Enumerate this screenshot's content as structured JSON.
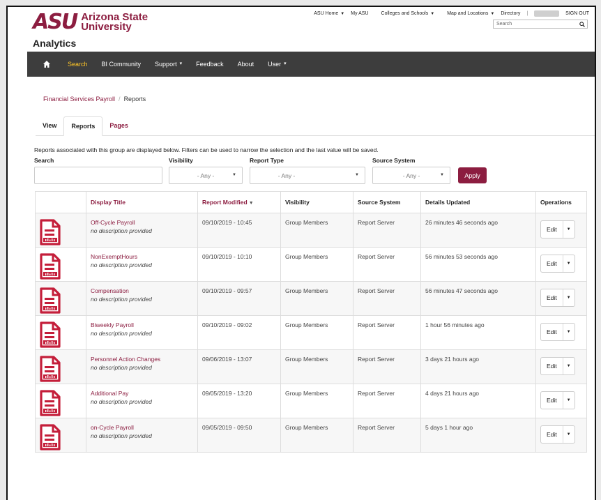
{
  "header": {
    "logo_mark": "ASU",
    "logo_line1": "Arizona State",
    "logo_line2": "University",
    "topnav": [
      "ASU Home",
      "My ASU",
      "Colleges and Schools",
      "Map and Locations",
      "Directory"
    ],
    "sign_out": "SIGN OUT",
    "search_placeholder": "Search",
    "app_title": "Analytics"
  },
  "navbar": {
    "items": [
      {
        "label": "Search",
        "active": true
      },
      {
        "label": "BI Community"
      },
      {
        "label": "Support"
      },
      {
        "label": "Feedback"
      },
      {
        "label": "About"
      },
      {
        "label": "User"
      }
    ]
  },
  "breadcrumb": {
    "parent": "Financial Services Payroll",
    "current": "Reports"
  },
  "tabs": [
    "View",
    "Reports",
    "Pages"
  ],
  "filters": {
    "description": "Reports associated with this group are displayed below. Filters can be used to narrow the selection and the last value will be saved.",
    "search_label": "Search",
    "visibility_label": "Visibility",
    "visibility_value": "- Any -",
    "report_type_label": "Report Type",
    "report_type_value": "- Any -",
    "source_system_label": "Source System",
    "source_system_value": "- Any -",
    "apply_label": "Apply"
  },
  "table": {
    "headers": {
      "title": "Display Title",
      "modified": "Report Modified",
      "visibility": "Visibility",
      "source": "Source System",
      "updated": "Details Updated",
      "operations": "Operations"
    },
    "edit_label": "Edit",
    "rows": [
      {
        "title": "Off-Cycle Payroll",
        "desc": "no description provided",
        "modified": "09/10/2019 - 10:45",
        "visibility": "Group Members",
        "source": "Report Server",
        "updated": "26 minutes 46 seconds ago"
      },
      {
        "title": "NonExemptHours",
        "desc": "no description provided",
        "modified": "09/10/2019 - 10:10",
        "visibility": "Group Members",
        "source": "Report Server",
        "updated": "56 minutes 53 seconds ago"
      },
      {
        "title": "Compensation",
        "desc": "no description provided",
        "modified": "09/10/2019 - 09:57",
        "visibility": "Group Members",
        "source": "Report Server",
        "updated": "56 minutes 47 seconds ago"
      },
      {
        "title": "Biweekly Payroll",
        "desc": "no description provided",
        "modified": "09/10/2019 - 09:02",
        "visibility": "Group Members",
        "source": "Report Server",
        "updated": "1 hour 56 minutes ago"
      },
      {
        "title": "Personnel Action Changes",
        "desc": "no description provided",
        "modified": "09/06/2019 - 13:07",
        "visibility": "Group Members",
        "source": "Report Server",
        "updated": "3 days 21 hours ago"
      },
      {
        "title": "Additional Pay",
        "desc": "no description provided",
        "modified": "09/05/2019 - 13:20",
        "visibility": "Group Members",
        "source": "Report Server",
        "updated": "4 days 21 hours ago"
      },
      {
        "title": "on-Cycle Payroll",
        "desc": "no description provided",
        "modified": "09/05/2019 - 09:50",
        "visibility": "Group Members",
        "source": "Report Server",
        "updated": "5 days 1 hour ago"
      }
    ]
  },
  "colors": {
    "brand": "#8c1d40",
    "nav_bg": "#3d3d3d",
    "nav_active": "#ffc627"
  }
}
